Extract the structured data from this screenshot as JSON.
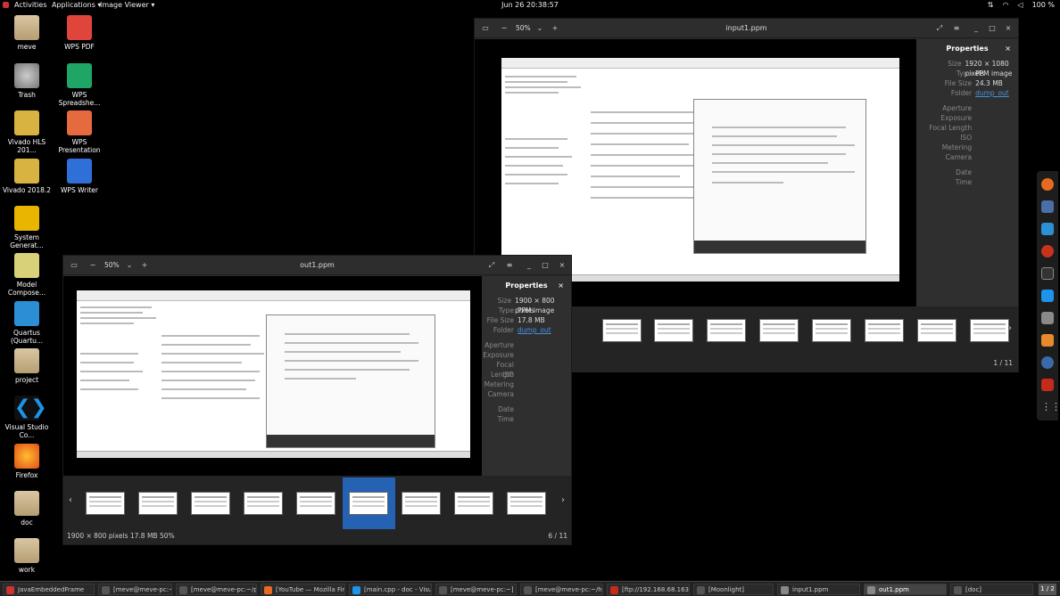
{
  "topbar": {
    "activities": "Activities",
    "applications": "Applications ▾",
    "image_viewer": "Image Viewer ▾",
    "clock": "Jun 26  20:38:57",
    "battery": "100 %"
  },
  "desktop": {
    "icons": [
      {
        "label": "meve"
      },
      {
        "label": "WPS PDF"
      },
      {
        "label": "Trash"
      },
      {
        "label": "WPS Spreadshe..."
      },
      {
        "label": "Vivado HLS 201..."
      },
      {
        "label": "WPS Presentation"
      },
      {
        "label": "Vivado 2018.2"
      },
      {
        "label": "WPS Writer"
      },
      {
        "label": "System Generat..."
      },
      {
        "label": "Model Compose..."
      },
      {
        "label": "Quartus (Quartu..."
      },
      {
        "label": "project"
      },
      {
        "label": "Visual Studio Co..."
      },
      {
        "label": "Firefox"
      },
      {
        "label": "doc"
      },
      {
        "label": "work"
      }
    ]
  },
  "window_input": {
    "title": "input1.ppm",
    "zoom": "50%",
    "properties": {
      "title": "Properties",
      "rows": [
        {
          "k": "Size",
          "v": "1920 × 1080 pixels"
        },
        {
          "k": "Type",
          "v": "PPM image"
        },
        {
          "k": "File Size",
          "v": "24.3 MB"
        },
        {
          "k": "Folder",
          "v": "dump_out"
        },
        {
          "k": "Aperture",
          "v": ""
        },
        {
          "k": "Exposure",
          "v": ""
        },
        {
          "k": "Focal Length",
          "v": ""
        },
        {
          "k": "ISO",
          "v": ""
        },
        {
          "k": "Metering",
          "v": ""
        },
        {
          "k": "Camera",
          "v": ""
        },
        {
          "k": "Date",
          "v": ""
        },
        {
          "k": "Time",
          "v": ""
        }
      ]
    },
    "counter": "1 / 11"
  },
  "window_out": {
    "title": "out1.ppm",
    "zoom": "50%",
    "properties": {
      "title": "Properties",
      "rows": [
        {
          "k": "Size",
          "v": "1900 × 800 pixels"
        },
        {
          "k": "Type",
          "v": "PPM image"
        },
        {
          "k": "File Size",
          "v": "17.8 MB"
        },
        {
          "k": "Folder",
          "v": "dump_out"
        },
        {
          "k": "Aperture",
          "v": ""
        },
        {
          "k": "Exposure",
          "v": ""
        },
        {
          "k": "Focal Length",
          "v": ""
        },
        {
          "k": "ISO",
          "v": ""
        },
        {
          "k": "Metering",
          "v": ""
        },
        {
          "k": "Camera",
          "v": ""
        },
        {
          "k": "Date",
          "v": ""
        },
        {
          "k": "Time",
          "v": ""
        }
      ]
    },
    "status": "1900 × 800 pixels   17.8 MB   50%",
    "counter": "6 / 11"
  },
  "taskbar": {
    "items": [
      "JavaEmbeddedFrame",
      "[meve@meve-pc:~]",
      "[meve@meve-pc:~/proje...",
      "[YouTube — Mozilla Firef...",
      "[main.cpp - doc - Visual ...",
      "[meve@meve-pc:~]",
      "[meve@meve-pc:~/home/...",
      "[ftp://192.168.68.163:2...",
      "[Moonlight]",
      "input1.ppm",
      "out1.ppm",
      "[doc]"
    ],
    "pager": "1 / 2"
  },
  "colors": {
    "link": "#4a8fe0",
    "selection": "#2562b3"
  }
}
